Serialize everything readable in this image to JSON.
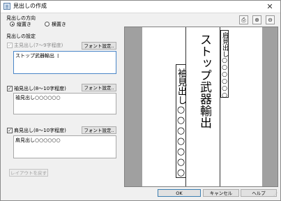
{
  "window": {
    "title": "見出しの作成"
  },
  "direction": {
    "label": "見出しの方向",
    "options": [
      {
        "label": "縦置き",
        "selected": true
      },
      {
        "label": "横置き",
        "selected": false
      }
    ]
  },
  "settings": {
    "label": "見出しの設定",
    "main": {
      "label": "主見出し(7〜9字程度)",
      "checked": true,
      "enabled": false,
      "font_button": "フォント設定..",
      "value": "ストップ武器輸出"
    },
    "sub": {
      "label": "袖見出し(8〜10字程度)",
      "checked": true,
      "font_button": "フォント設定..",
      "value": "袖見出し○○○○○○"
    },
    "shoulder": {
      "label": "肩見出し(8〜10字程度)",
      "checked": true,
      "font_button": "フォント設定..",
      "value": "肩見出し○○○○○○"
    },
    "reset_button": "レイアウトを戻す"
  },
  "preview": {
    "shoulder_text": "肩見出し○○○○○○",
    "main_text": "ストップ武器輸出",
    "sub_text": "袖見出し○○○○○○○"
  },
  "toolbar": {
    "print_icon": "printer-icon",
    "zoom_in_icon": "zoom-in-icon",
    "zoom_out_icon": "zoom-out-icon"
  },
  "buttons": {
    "ok": "OK",
    "cancel": "キャンセル",
    "help": "ヘルプ"
  },
  "close_glyph": "✕"
}
